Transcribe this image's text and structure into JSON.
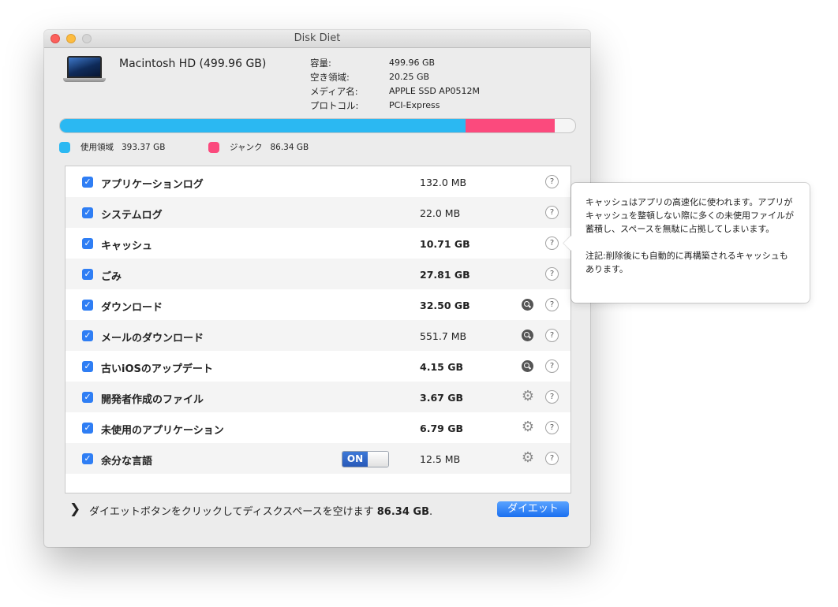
{
  "window": {
    "title": "Disk Diet"
  },
  "disk": {
    "name": "Macintosh HD (499.96 GB)",
    "info": [
      {
        "label": "容量:",
        "value": "499.96 GB"
      },
      {
        "label": "空き領域:",
        "value": "20.25 GB"
      },
      {
        "label": "メディア名:",
        "value": "APPLE SSD AP0512M"
      },
      {
        "label": "プロトコル:",
        "value": "PCI-Express"
      }
    ]
  },
  "usage": {
    "used_fraction": 0.787,
    "junk_fraction": 0.173,
    "legend": [
      {
        "label": "使用領域",
        "amount": "393.37 GB",
        "color": "#2bb8f2"
      },
      {
        "label": "ジャンク",
        "amount": "86.34 GB",
        "color": "#fb4a7d"
      }
    ]
  },
  "items": [
    {
      "name": "アプリケーションログ",
      "size": "132.0 MB",
      "checked": true
    },
    {
      "name": "システムログ",
      "size": "22.0 MB",
      "checked": true
    },
    {
      "name": "キャッシュ",
      "size": "10.71 GB",
      "checked": true
    },
    {
      "name": "ごみ",
      "size": "27.81 GB",
      "checked": true
    },
    {
      "name": "ダウンロード",
      "size": "32.50 GB",
      "checked": true
    },
    {
      "name": "メールのダウンロード",
      "size": "551.7 MB",
      "checked": true
    },
    {
      "name": "古いiOSのアップデート",
      "size": "4.15 GB",
      "checked": true
    },
    {
      "name": "開発者作成のファイル",
      "size": "3.67 GB",
      "checked": true
    },
    {
      "name": "未使用のアプリケーション",
      "size": "6.79 GB",
      "checked": true
    },
    {
      "name": "余分な言語",
      "size": "12.5 MB",
      "checked": true,
      "toggle_label": "ON"
    }
  ],
  "footer": {
    "text_prefix": "ダイエットボタンをクリックしてディスクスペースを空けます",
    "amount": "86.34 GB",
    "text_suffix": ".",
    "diet_button": "ダイエット"
  },
  "tooltip": {
    "paragraph1": "キャッシュはアプリの高速化に使われます。アプリがキャッシュを整頓しない際に多くの未使用ファイルが蓄積し、スペースを無駄に占拠してしまいます。",
    "paragraph2": "注記:削除後にも自動的に再構築されるキャッシュもあります。"
  },
  "colors": {
    "accent": "#2f7ef4",
    "used": "#2bb8f2",
    "junk": "#fb4a7d"
  }
}
